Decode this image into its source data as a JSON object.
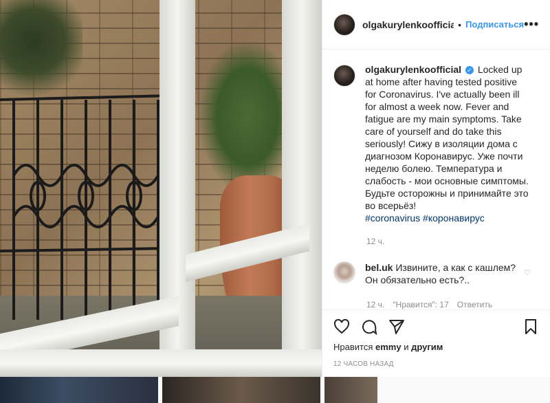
{
  "post": {
    "username": "olgakurylenkoofficial",
    "dot": "•",
    "follow_label": "Подписаться",
    "more": "•••",
    "caption": "Locked up at home after having tested positive for Coronavirus. I've actually been ill for almost a week now. Fever and fatigue are my main symptoms. Take care of yourself and do take this seriously! Сижу в изоляции дома с диагнозом Коронавирус. Уже почти неделю болею. Температура и слабость - мои основные симптомы. Будьте осторожны и принимайте это во всерьёз!",
    "hashtags": "#coronavirus #коронавирус",
    "caption_time": "12 ч."
  },
  "comment": {
    "username": "bel.uk",
    "text": "Извините, а как с кашлем? Он обязательно есть?..",
    "time": "12 ч.",
    "likes": "\"Нравится\": 17",
    "reply": "Ответить"
  },
  "footer": {
    "likes_prefix": "Нравится",
    "liked_by": "emmy",
    "and": "и",
    "others": "другим",
    "timestamp": "12 ЧАСОВ НАЗАД"
  },
  "icons": [
    "heart-icon",
    "comment-icon",
    "share-icon",
    "bookmark-icon",
    "verified-icon"
  ],
  "colors": {
    "accent": "#3897f0",
    "hashtag": "#00376b",
    "muted": "#8e8e8e"
  }
}
